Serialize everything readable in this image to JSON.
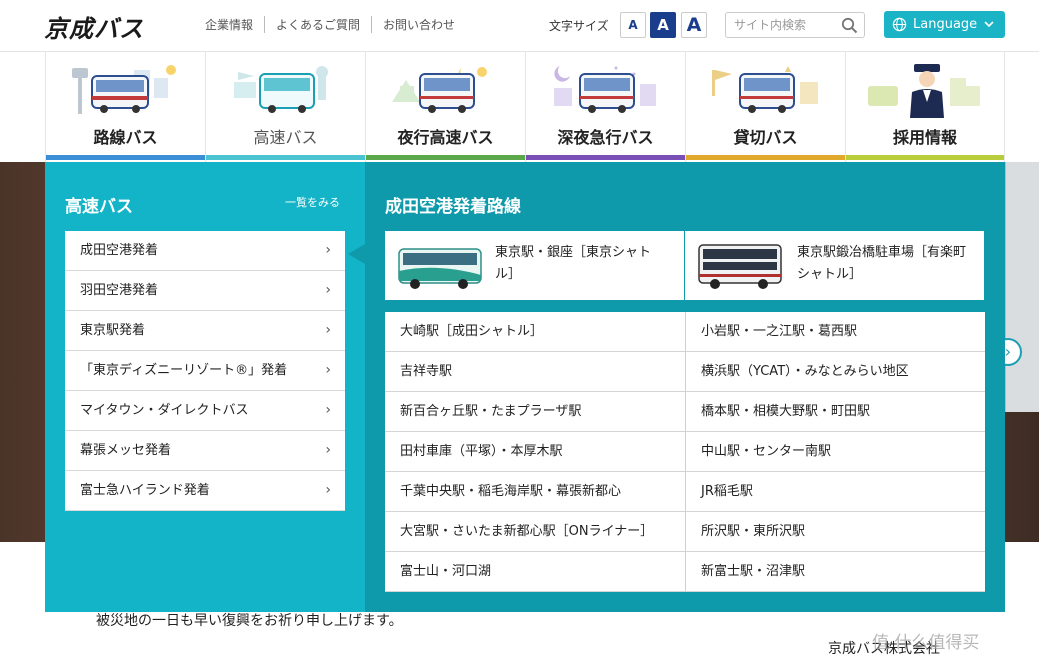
{
  "header": {
    "logo": "京成バス",
    "links": [
      "企業情報",
      "よくあるご質問",
      "お問い合わせ"
    ],
    "font_size_label": "文字サイズ",
    "font_size_options": [
      "A",
      "A",
      "A"
    ],
    "search_placeholder": "サイト内検索",
    "language_label": "Language"
  },
  "nav": {
    "tabs": [
      {
        "label": "路線バス",
        "color": "#3a8fd6"
      },
      {
        "label": "高速バス",
        "color": "#4cc3d1"
      },
      {
        "label": "夜行高速バス",
        "color": "#5aa84a"
      },
      {
        "label": "深夜急行バス",
        "color": "#7a4fb5"
      },
      {
        "label": "貸切バス",
        "color": "#e0a92c"
      },
      {
        "label": "採用情報",
        "color": "#b8cc3c"
      }
    ]
  },
  "mega": {
    "left_title": "高速バス",
    "view_all": "一覧をみる",
    "items": [
      "成田空港発着",
      "羽田空港発着",
      "東京駅発着",
      "「東京ディズニーリゾート®」発着",
      "マイタウン・ダイレクトバス",
      "幕張メッセ発着",
      "富士急ハイランド発着"
    ],
    "right_title": "成田空港発着路線",
    "features": [
      {
        "text": "東京駅・銀座［東京シャトル］"
      },
      {
        "text": "東京駅鍛冶橋駐車場［有楽町シャトル］"
      }
    ],
    "routes": [
      [
        "大崎駅［成田シャトル］",
        "小岩駅・一之江駅・葛西駅"
      ],
      [
        "吉祥寺駅",
        "横浜駅（YCAT）・みなとみらい地区"
      ],
      [
        "新百合ヶ丘駅・たまプラーザ駅",
        "橋本駅・相模大野駅・町田駅"
      ],
      [
        "田村車庫（平塚）・本厚木駅",
        "中山駅・センター南駅"
      ],
      [
        "千葉中央駅・稲毛海岸駅・幕張新都心",
        "JR稲毛駅"
      ],
      [
        "大宮駅・さいたま新都心駅［ONライナー］",
        "所沢駅・東所沢駅"
      ],
      [
        "富士山・河口湖",
        "新富士駅・沼津駅"
      ]
    ]
  },
  "content": {
    "notice": "被災地の一日も早い復興をお祈り申し上げます。",
    "signature": "京成バス株式会社",
    "watermark": "值 什么值得买"
  }
}
